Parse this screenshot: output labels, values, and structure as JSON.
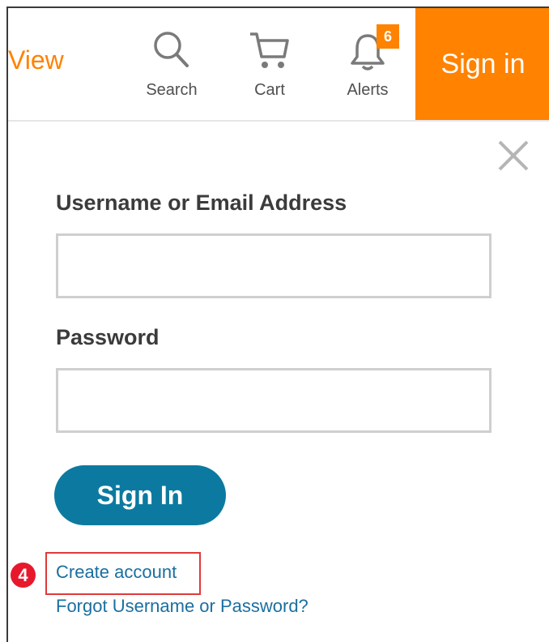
{
  "header": {
    "view_label": "View",
    "search_label": "Search",
    "cart_label": "Cart",
    "alerts_label": "Alerts",
    "alerts_count": "6",
    "sign_in_label": "Sign in"
  },
  "form": {
    "username_label": "Username or Email Address",
    "username_value": "",
    "password_label": "Password",
    "password_value": "",
    "sign_in_button": "Sign In",
    "step_number": "4",
    "create_account": "Create account",
    "forgot_link": "Forgot Username or Password?"
  },
  "colors": {
    "accent": "#ff8200",
    "primary_button": "#0c7aa0",
    "link": "#1a6fa1",
    "annotation_red": "#e8182c"
  },
  "icons": [
    "search-icon",
    "cart-icon",
    "bell-icon",
    "close-icon"
  ]
}
